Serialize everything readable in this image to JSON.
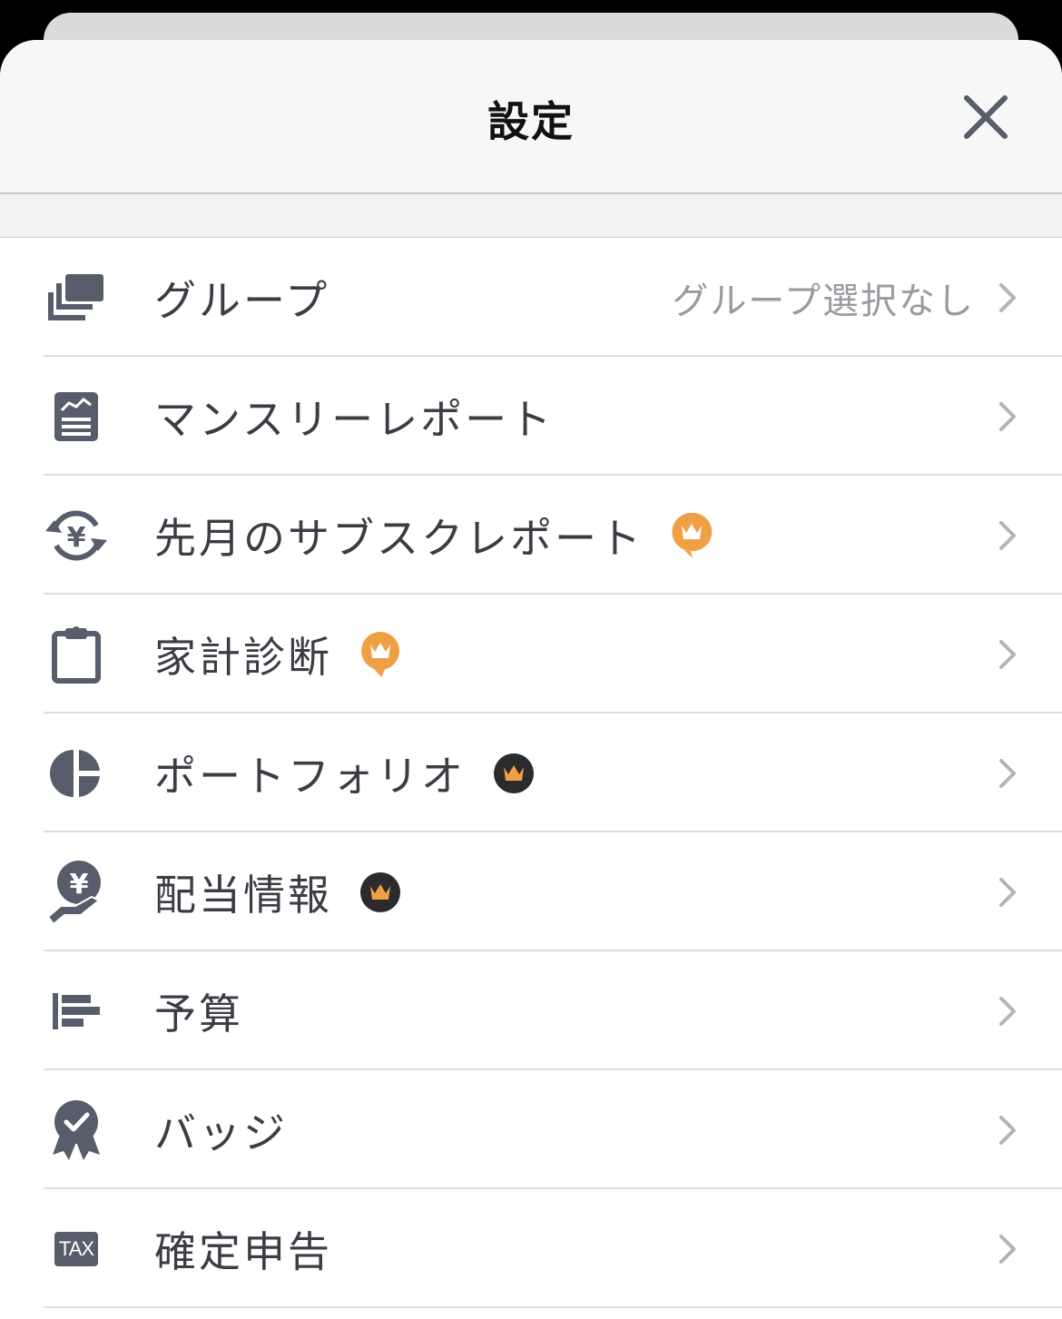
{
  "header": {
    "title": "設定"
  },
  "menu": [
    {
      "label": "グループ",
      "value": "グループ選択なし",
      "icon": "group-icon",
      "badge": null
    },
    {
      "label": "マンスリーレポート",
      "value": "",
      "icon": "monthly-report-icon",
      "badge": null
    },
    {
      "label": "先月のサブスクレポート",
      "value": "",
      "icon": "yen-cycle-icon",
      "badge": "premium-orange"
    },
    {
      "label": "家計診断",
      "value": "",
      "icon": "clipboard-icon",
      "badge": "premium-orange"
    },
    {
      "label": "ポートフォリオ",
      "value": "",
      "icon": "pie-chart-icon",
      "badge": "premium-dark"
    },
    {
      "label": "配当情報",
      "value": "",
      "icon": "yen-hand-icon",
      "badge": "premium-dark"
    },
    {
      "label": "予算",
      "value": "",
      "icon": "budget-bars-icon",
      "badge": null
    },
    {
      "label": "バッジ",
      "value": "",
      "icon": "award-badge-icon",
      "badge": null
    },
    {
      "label": "確定申告",
      "value": "",
      "icon": "tax-icon",
      "icon_text": "TAX",
      "badge": null
    }
  ],
  "colors": {
    "icon": "#585d6c",
    "badge_orange": "#f0a044",
    "badge_dark": "#2b2b2e",
    "text": "#3b3d44",
    "secondary": "#9a9ba0"
  }
}
